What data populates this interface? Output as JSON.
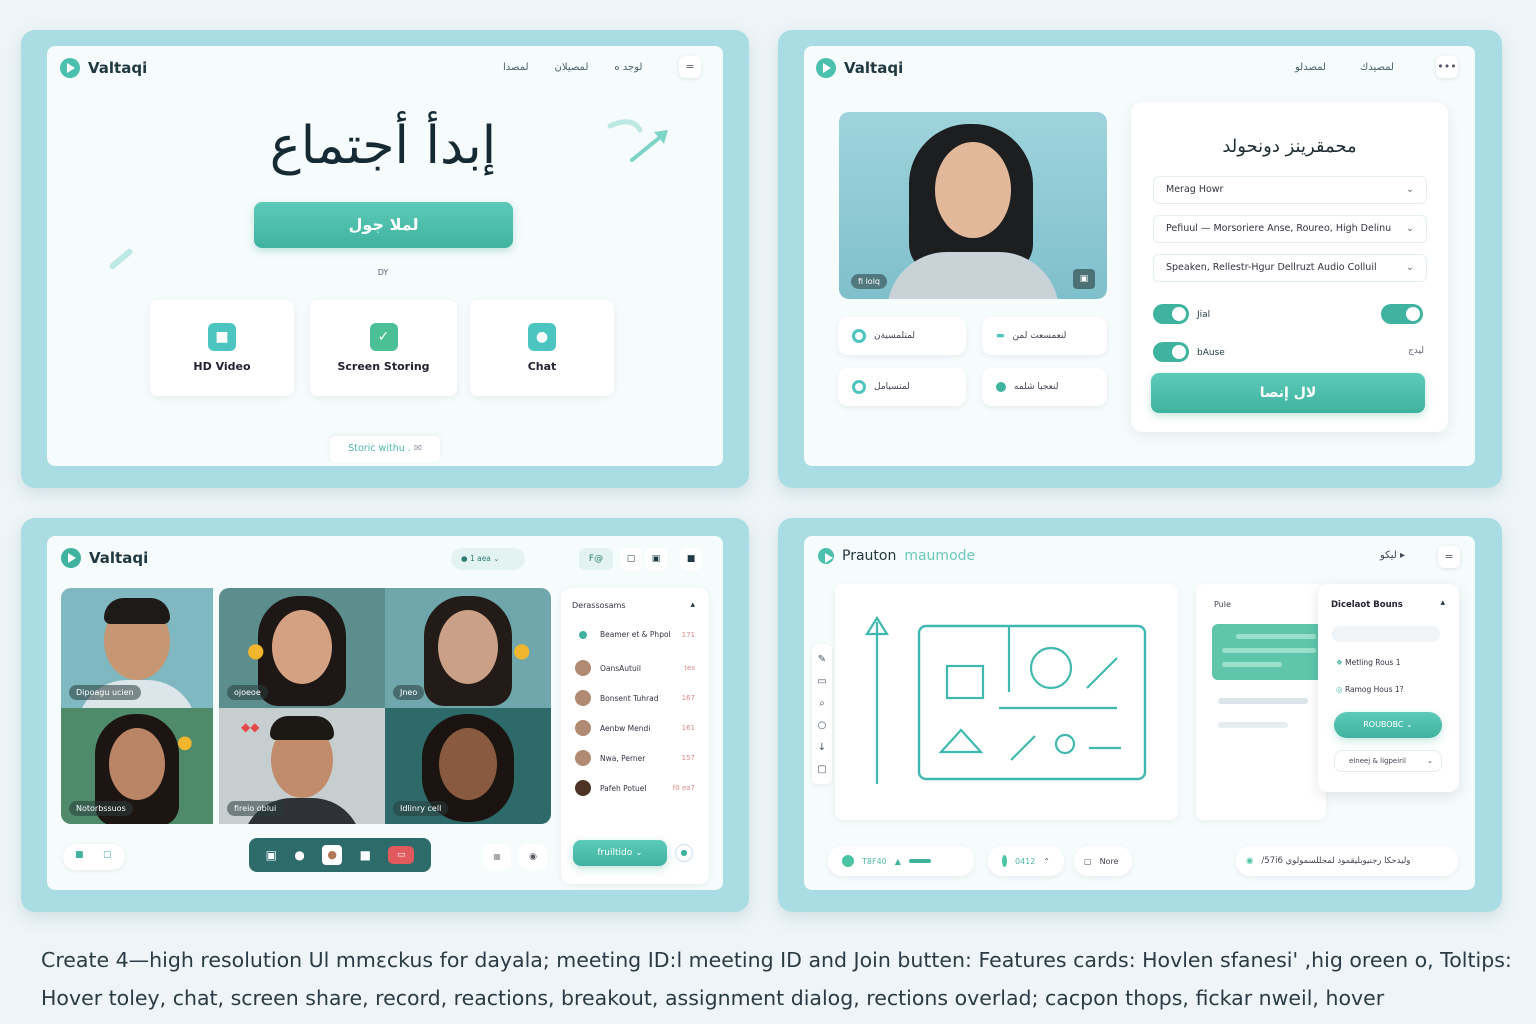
{
  "panel1": {
    "logo": "Valtaqi",
    "nav": [
      "لمصدا",
      "لمصيلان",
      "لوجد ه"
    ],
    "menu": "=",
    "title": "إبدأ أجتماع",
    "join_label": "لملا جول",
    "or_label": "DY",
    "features": [
      {
        "icon": "video-icon",
        "label": "HD Video"
      },
      {
        "icon": "screen-share-icon",
        "label": "Screen Storing"
      },
      {
        "icon": "chat-icon",
        "label": "Chat"
      }
    ],
    "tooltip": "Storic withu ."
  },
  "panel2": {
    "logo": "Valtaqi",
    "nav": [
      "لمصدلو",
      "لمصيدك"
    ],
    "menu": "•••",
    "preview_label": "fi lolq",
    "dialog_title": "محمقرينز دونحولد",
    "selects": [
      "Merag Howr",
      "Pefiuul — Morsoriere Anse, Roureo, High Delinu",
      "Speaken, Rellestr-Hgur Dellruzt Audio    Colluil"
    ],
    "toggles": [
      {
        "label": "Jial",
        "value": ""
      },
      {
        "label": "bAuse",
        "value": "ليدج"
      }
    ],
    "join_label": "لال إنصا",
    "chips": [
      "لمتلمسيةن",
      "لنعمسعت لمن",
      "لمتسيامل",
      "لنعجيا شلمه"
    ]
  },
  "panel3": {
    "logo": "Valtaqi",
    "status_badge": "1 aea",
    "ctrl_label": "F@",
    "tiles": [
      {
        "label": "Dipoagu  ucien"
      },
      {
        "label": "ojoeoe"
      },
      {
        "label": "Jneo"
      },
      {
        "label": "Notorbssuos"
      },
      {
        "label": "fireio  oblui"
      },
      {
        "label": "Idlinry  cell"
      }
    ],
    "participants_title": "Derassosams",
    "participants": [
      {
        "name": "Beamer et & Phpol",
        "status": "171"
      },
      {
        "name": "OansAutuil",
        "status": "tes"
      },
      {
        "name": "Bonsent Tuhrad",
        "status": "167"
      },
      {
        "name": "Aenbw Mendi",
        "status": "161"
      },
      {
        "name": "Nwa,  Perner",
        "status": "157"
      },
      {
        "name": "Pafeh Potuel",
        "status": "f0 ea7"
      }
    ],
    "invite_label": "fruiltido"
  },
  "panel4": {
    "logo": "Prauton",
    "logo_accent": "maumode",
    "nav": "ليكو ▸",
    "menu": "=",
    "left_label": "Pule",
    "breakout_title": "Dicelaot Bouns",
    "rooms": [
      {
        "label": "Metling Rous  1"
      },
      {
        "label": "Ramog Hous 1?"
      }
    ],
    "assign_label": "ROUBOBC",
    "select_label": "elneej & ligpeiril",
    "bottom": [
      {
        "label": "T8F40"
      },
      {
        "label": "0412"
      },
      {
        "label": "Nore"
      }
    ],
    "caption_right": "/57i6   وليدحكا  رجنيوبليقمود  لمجللسمولوي"
  },
  "footer": [
    "Create 4—high resolution Ul mmεckus for dayala; meeting ID:l meeting ID  and Join butten: Features cards: Hovlen sfanesi'  ,hig oreen o, Toltips:",
    "Hover toley, chat, screen share, record, reactions, breakout, assignment  dialog,  rections  overlad; cacpon thops, fickar nweil, hover"
  ],
  "colors": {
    "accent": "#3fb39f",
    "frame": "#a9dde3",
    "card": "#f6fbfc"
  }
}
